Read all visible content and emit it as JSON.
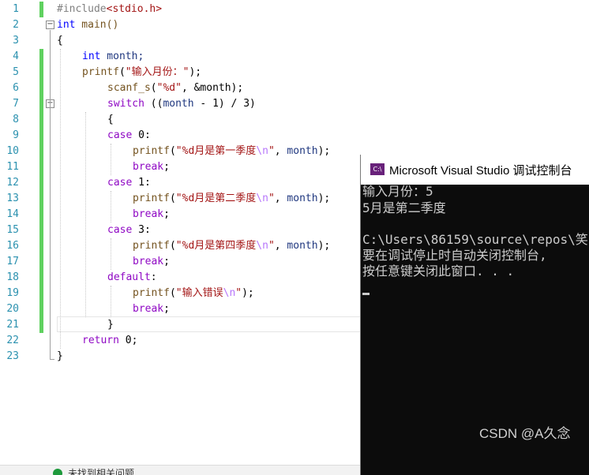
{
  "editor": {
    "line_numbers": [
      "1",
      "2",
      "3",
      "4",
      "5",
      "6",
      "7",
      "8",
      "9",
      "10",
      "11",
      "12",
      "13",
      "14",
      "15",
      "16",
      "17",
      "18",
      "19",
      "20",
      "21",
      "22",
      "23"
    ],
    "fold_markers": [
      "−",
      "−"
    ],
    "lines": {
      "l1": [
        "#include",
        "<stdio.h>"
      ],
      "l2": [
        "int",
        " main()"
      ],
      "l3": [
        "{"
      ],
      "l4": [
        "int",
        " month;"
      ],
      "l5": [
        "printf",
        "(",
        "\"输入月份：\"",
        ");"
      ],
      "l6": [
        "scanf_s",
        "(",
        "\"%d\"",
        ", &month);"
      ],
      "l7": [
        "switch",
        " ((",
        "month",
        " - 1) / 3)"
      ],
      "l8": [
        "{"
      ],
      "l9": [
        "case",
        " 0:"
      ],
      "l10": [
        "printf",
        "(",
        "\"%d月是第一季度",
        "\\n",
        "\"",
        ", ",
        "month",
        ");"
      ],
      "l11": [
        "break",
        ";"
      ],
      "l12": [
        "case",
        " 1:"
      ],
      "l13": [
        "printf",
        "(",
        "\"%d月是第二季度",
        "\\n",
        "\"",
        ", ",
        "month",
        ");"
      ],
      "l14": [
        "break",
        ";"
      ],
      "l15": [
        "case",
        " 3:"
      ],
      "l16": [
        "printf",
        "(",
        "\"%d月是第四季度",
        "\\n",
        "\"",
        ", ",
        "month",
        ");"
      ],
      "l17": [
        "break",
        ";"
      ],
      "l18": [
        "default",
        ":"
      ],
      "l19": [
        "printf",
        "(",
        "\"输入错误",
        "\\n",
        "\"",
        ");"
      ],
      "l20": [
        "break",
        ";"
      ],
      "l21": [
        "}"
      ],
      "l22": [
        "return",
        " 0;"
      ],
      "l23": [
        "}"
      ]
    },
    "colors": {
      "keyword": "#0000ff",
      "function": "#74531f",
      "string": "#a31515",
      "escape": "#b776fb",
      "control": "#8f08c4",
      "line_number": "#2b91af",
      "change_marker": "#5fd15f"
    }
  },
  "status_bar": {
    "icon": "check-circle-icon",
    "text": "未找到相关问题"
  },
  "console": {
    "icon": "visual-studio-icon",
    "icon_text": "C:\\",
    "title": "Microsoft Visual Studio 调试控制台",
    "output_lines": [
      "输入月份：5",
      "5月是第二季度",
      "",
      "C:\\Users\\86159\\source\\repos\\笑",
      "要在调试停止时自动关闭控制台,",
      "按任意键关闭此窗口. . ."
    ],
    "watermark": "CSDN @A久念"
  }
}
